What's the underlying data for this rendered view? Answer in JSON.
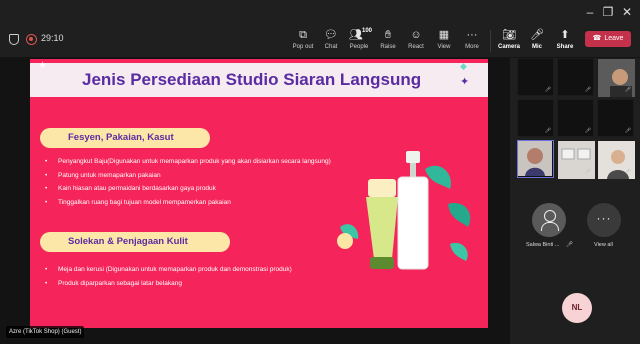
{
  "toolbar": {
    "timer": "29:10",
    "buttons": [
      {
        "label": "Pop out",
        "icon": "pop-out-icon"
      },
      {
        "label": "Chat",
        "icon": "chat-icon"
      },
      {
        "label": "People",
        "icon": "people-icon",
        "count": "100"
      },
      {
        "label": "Raise",
        "icon": "raise-hand-icon"
      },
      {
        "label": "React",
        "icon": "react-icon"
      },
      {
        "label": "View",
        "icon": "view-icon"
      },
      {
        "label": "More",
        "icon": "more-icon"
      },
      {
        "label": "Camera",
        "icon": "camera-off-icon"
      },
      {
        "label": "Mic",
        "icon": "mic-off-icon"
      },
      {
        "label": "Share",
        "icon": "share-icon"
      }
    ],
    "leave_label": "Leave",
    "accent": "#c4314b"
  },
  "slide": {
    "title": "Jenis Persediaan Studio Siaran Langsung",
    "section1": {
      "heading": "Fesyen, Pakaian, Kasut",
      "items": [
        "Penyangkut Baju(Digunakan untuk memaparkan produk yang akan disiarkan secara langsung)",
        "Patung untuk memaparkan pakaian",
        "Kain hiasan atau permaidani berdasarkan gaya produk",
        "Tinggalkan ruang bagi tujuan model mempamerkan pakaian"
      ]
    },
    "section2": {
      "heading": "Solekan & Penjagaan Kulit",
      "items": [
        "Meja dan kerusi (Digunakan untuk memaparkan produk dan demonstrasi produk)",
        "Produk diparparkan sebagai latar belakang"
      ]
    },
    "colors": {
      "background": "#f5245a",
      "title": "#5a2ca2",
      "pill": "#fde7a8"
    }
  },
  "presenter_label": "Azre (TikTok Shop) (Guest)",
  "participants": {
    "tile_name": "Salwa Binti ...",
    "view_all_label": "View all",
    "my_initials": "NL"
  }
}
